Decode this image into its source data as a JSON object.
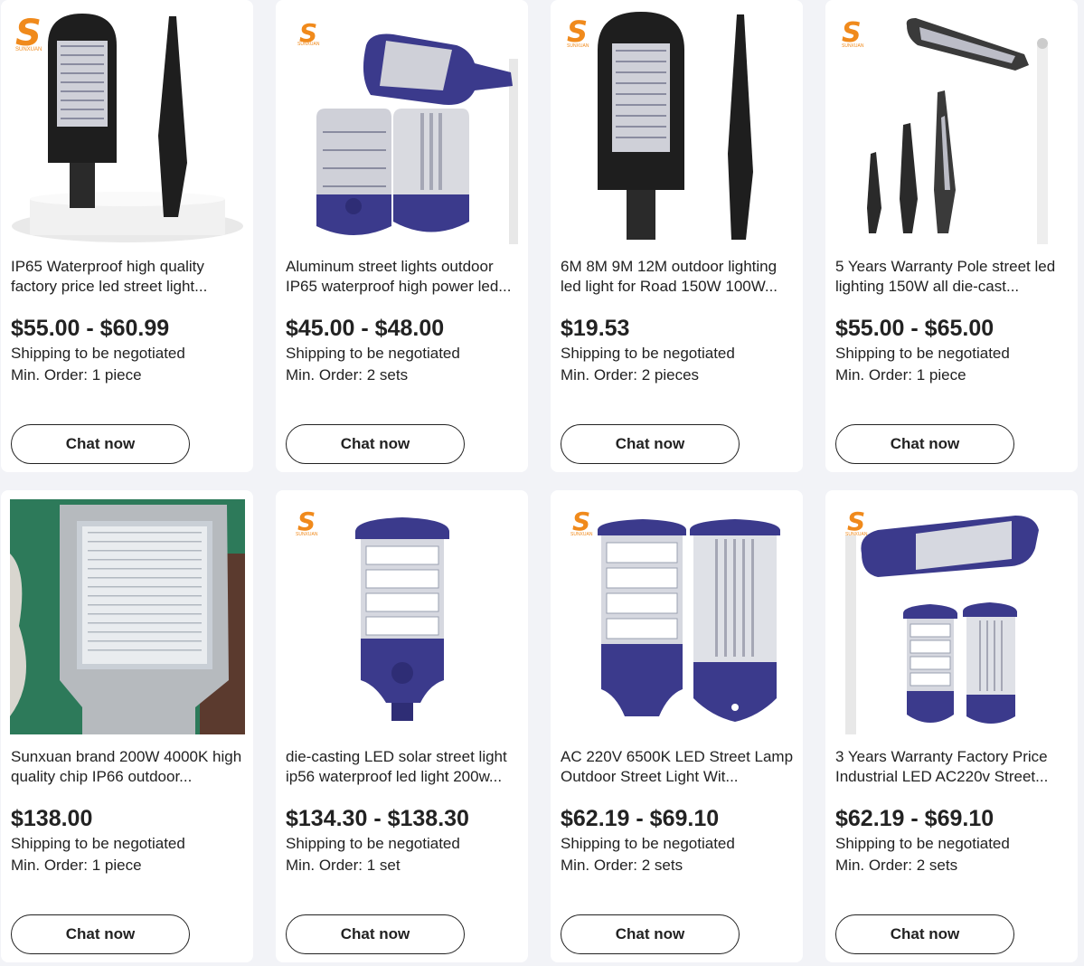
{
  "products": [
    {
      "title": "IP65 Waterproof high quality factory price led street light...",
      "price": "$55.00 - $60.99",
      "shipping": "Shipping to be negotiated",
      "min_order": "Min. Order: 1 piece",
      "chat_label": "Chat now",
      "brand_logo_text": "SUNXUAN"
    },
    {
      "title": "Aluminum street lights outdoor IP65 waterproof high power led...",
      "price": "$45.00 - $48.00",
      "shipping": "Shipping to be negotiated",
      "min_order": "Min. Order: 2 sets",
      "chat_label": "Chat now",
      "brand_logo_text": "SUNXUAN"
    },
    {
      "title": "6M 8M 9M 12M outdoor lighting led light for Road 150W 100W...",
      "price": "$19.53",
      "shipping": "Shipping to be negotiated",
      "min_order": "Min. Order: 2 pieces",
      "chat_label": "Chat now",
      "brand_logo_text": "SUNXUAN"
    },
    {
      "title": "5 Years Warranty Pole street led lighting 150W all die-cast...",
      "price": "$55.00 - $65.00",
      "shipping": "Shipping to be negotiated",
      "min_order": "Min. Order: 1 piece",
      "chat_label": "Chat now",
      "brand_logo_text": "SUNXUAN"
    },
    {
      "title": "Sunxuan brand 200W 4000K high quality chip IP66 outdoor...",
      "price": "$138.00",
      "shipping": "Shipping to be negotiated",
      "min_order": "Min. Order: 1 piece",
      "chat_label": "Chat now"
    },
    {
      "title": "die-casting LED solar street light ip56 waterproof led light 200w...",
      "price": "$134.30 - $138.30",
      "shipping": "Shipping to be negotiated",
      "min_order": "Min. Order: 1 set",
      "chat_label": "Chat now",
      "brand_logo_text": "SUNXUAN"
    },
    {
      "title": "AC 220V 6500K LED Street Lamp Outdoor Street Light Wit...",
      "price": "$62.19 - $69.10",
      "shipping": "Shipping to be negotiated",
      "min_order": "Min. Order: 2 sets",
      "chat_label": "Chat now",
      "brand_logo_text": "SUNXUAN"
    },
    {
      "title": "3 Years Warranty Factory Price Industrial LED AC220v Street...",
      "price": "$62.19 - $69.10",
      "shipping": "Shipping to be negotiated",
      "min_order": "Min. Order: 2 sets",
      "chat_label": "Chat now",
      "brand_logo_text": "SUNXUAN"
    }
  ],
  "colors": {
    "page_background": "#f2f3f7",
    "card_background": "#ffffff",
    "text": "#222222",
    "lamp_blue": "#3b3a8c",
    "lamp_black": "#1e1e1e",
    "logo_orange": "#f08a1c"
  }
}
